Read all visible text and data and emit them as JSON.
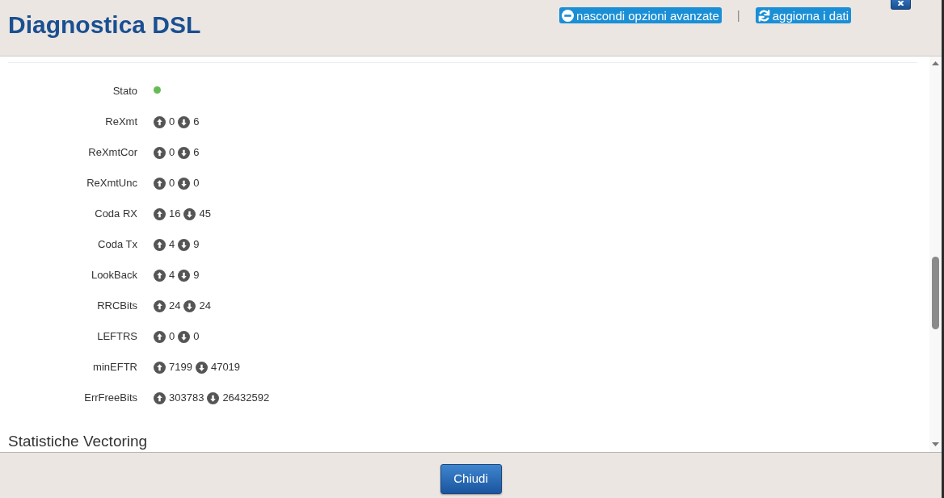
{
  "window": {
    "title": "Diagnostica DSL"
  },
  "header_links": [
    {
      "kind": "hide",
      "label": "nascondi opzioni avanzate"
    },
    {
      "kind": "refresh",
      "label": "aggiorna i dati"
    }
  ],
  "separator": "|",
  "status": {
    "label": "Stato",
    "color": "#66bb55"
  },
  "rows": [
    {
      "label": "ReXmt",
      "up": "0",
      "down": "6"
    },
    {
      "label": "ReXmtCor",
      "up": "0",
      "down": "6"
    },
    {
      "label": "ReXmtUnc",
      "up": "0",
      "down": "0"
    },
    {
      "label": "Coda RX",
      "up": "16",
      "down": "45"
    },
    {
      "label": "Coda Tx",
      "up": "4",
      "down": "9"
    },
    {
      "label": "LookBack",
      "up": "4",
      "down": "9"
    },
    {
      "label": "RRCBits",
      "up": "24",
      "down": "24"
    },
    {
      "label": "LEFTRS",
      "up": "0",
      "down": "0"
    },
    {
      "label": "minEFTR",
      "up": "7199",
      "down": "47019"
    },
    {
      "label": "ErrFreeBits",
      "up": "303783",
      "down": "26432592"
    }
  ],
  "section_title": "Statistiche Vectoring",
  "buttons": [
    "Chiudi"
  ]
}
